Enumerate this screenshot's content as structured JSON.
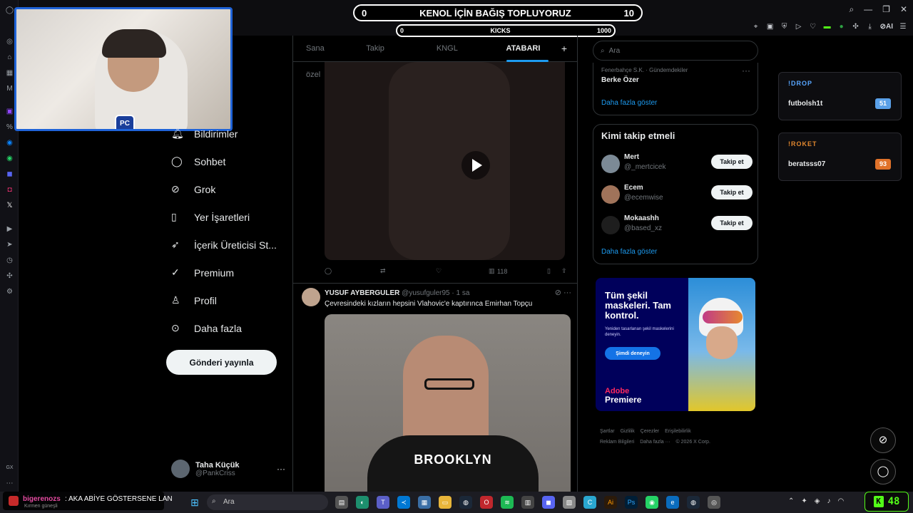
{
  "overlay": {
    "donation": {
      "left_value": "0",
      "title": "KENOL İÇİN BAĞIŞ TOPLUYORUZ",
      "right_value": "10"
    },
    "kicks": {
      "left_value": "0",
      "label": "KICKS",
      "right_value": "1000"
    },
    "drop_widgets": [
      {
        "command": "!DROP",
        "user": "futbolsh1t",
        "count": "51"
      },
      {
        "command": "!ROKET",
        "user": "beratsss07",
        "count": "93"
      }
    ],
    "chat": {
      "user": "bigerenozs",
      "message": ": AKA ABİYE GÖSTERSENE LAN",
      "weather": "Kırmen güneşli"
    },
    "kick_counter": "48",
    "colors": {
      "drop_accent": "#58a6ff",
      "roket_accent": "#e0862e",
      "kick_green": "#53fc18",
      "cam_border": "#1f63d8"
    }
  },
  "nav": {
    "items": [
      {
        "label": "Bildirimler",
        "icon": "bell-icon"
      },
      {
        "label": "Sohbet",
        "icon": "chat-bubble-icon"
      },
      {
        "label": "Grok",
        "icon": "grok-icon"
      },
      {
        "label": "Yer İşaretleri",
        "icon": "bookmark-icon"
      },
      {
        "label": "İçerik Üreticisi St...",
        "icon": "rocket-icon"
      },
      {
        "label": "Premium",
        "icon": "verified-badge-icon"
      },
      {
        "label": "Profil",
        "icon": "person-icon"
      },
      {
        "label": "Daha fazla",
        "icon": "more-circle-icon"
      }
    ],
    "post_button": "Gönderi yayınla",
    "account": {
      "name": "Taha Küçük",
      "handle": "@PankCriss"
    }
  },
  "timeline": {
    "tabs": [
      "Sana özel",
      "Takip ediliyor",
      "KNGL Social",
      "ATABARI"
    ],
    "active_tab": "ATABARI",
    "first_post_views": "118",
    "second_post": {
      "author": "YUSUF AYBERGULER",
      "handle": "@yusufguler95",
      "time": "· 1 sa",
      "text": "Çevresindeki kızların hepsini Vlahovic'e kaptırınca Emirhan Topçu",
      "shirt_text": "BROOKLYN"
    }
  },
  "sidebar": {
    "search_placeholder": "Ara",
    "trend": {
      "category": "Fenerbahçe S.K. · Gündemdekiler",
      "title": "Berke Özer",
      "more": "Daha fazla göster"
    },
    "who_to_follow": {
      "title": "Kimi takip etmeli",
      "users": [
        {
          "name": "Mert",
          "handle": "@_mertcicek",
          "button": "Takip et"
        },
        {
          "name": "Ecem",
          "handle": "@ecemwise",
          "button": "Takip et"
        },
        {
          "name": "Mokaashh",
          "handle": "@based_xz",
          "button": "Takip et"
        }
      ],
      "more": "Daha fazla göster"
    },
    "ad": {
      "headline": "Tüm şekil maskeleri. Tam kontrol.",
      "subtext": "Yeniden tasarlanan şekil maskelerini deneyin.",
      "cta": "Şimdi deneyin",
      "brand_top": "Adobe",
      "brand_bottom": "Premiere"
    },
    "footer": [
      "Şartlar",
      "Gizlilik",
      "Çerezler",
      "Erişilebilirlik",
      "Reklam Bilgileri",
      "Daha fazla ···",
      "© 2026 X Corp."
    ]
  },
  "taskbar": {
    "search_label": "Ara"
  }
}
